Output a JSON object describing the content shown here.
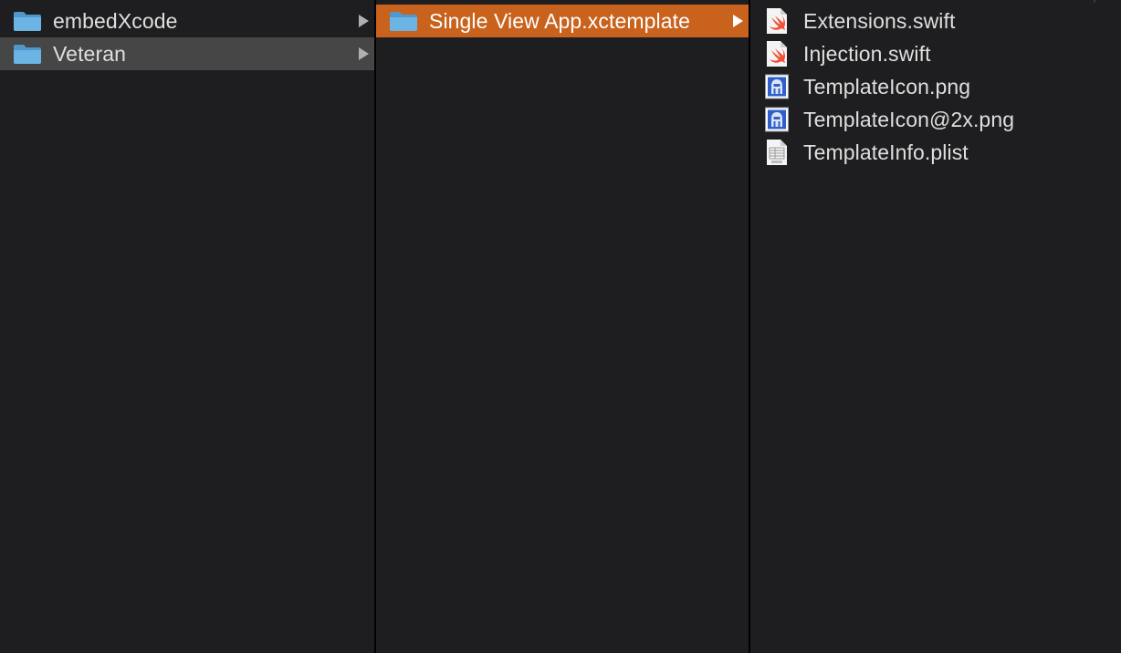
{
  "columns": [
    {
      "items": [
        {
          "label": "embedXcode",
          "icon": "folder-icon",
          "has_children": true,
          "state": "none"
        },
        {
          "label": "Veteran",
          "icon": "folder-icon",
          "has_children": true,
          "state": "inactive-selected"
        }
      ]
    },
    {
      "items": [
        {
          "label": "Single View App.xctemplate",
          "icon": "folder-icon",
          "has_children": true,
          "state": "active-selected"
        }
      ]
    },
    {
      "items": [
        {
          "label": "Extensions.swift",
          "icon": "swift-file-icon"
        },
        {
          "label": "Injection.swift",
          "icon": "swift-file-icon"
        },
        {
          "label": "TemplateIcon.png",
          "icon": "png-image-icon"
        },
        {
          "label": "TemplateIcon@2x.png",
          "icon": "png-image-icon"
        },
        {
          "label": "TemplateInfo.plist",
          "icon": "plist-file-icon"
        }
      ]
    }
  ],
  "colors": {
    "background": "#1e1e20",
    "active_selection": "#c8621d",
    "inactive_selection": "#464646",
    "text": "#dfdfdf",
    "folder_blue": "#5ea6d8",
    "swift_orange": "#f05138"
  }
}
